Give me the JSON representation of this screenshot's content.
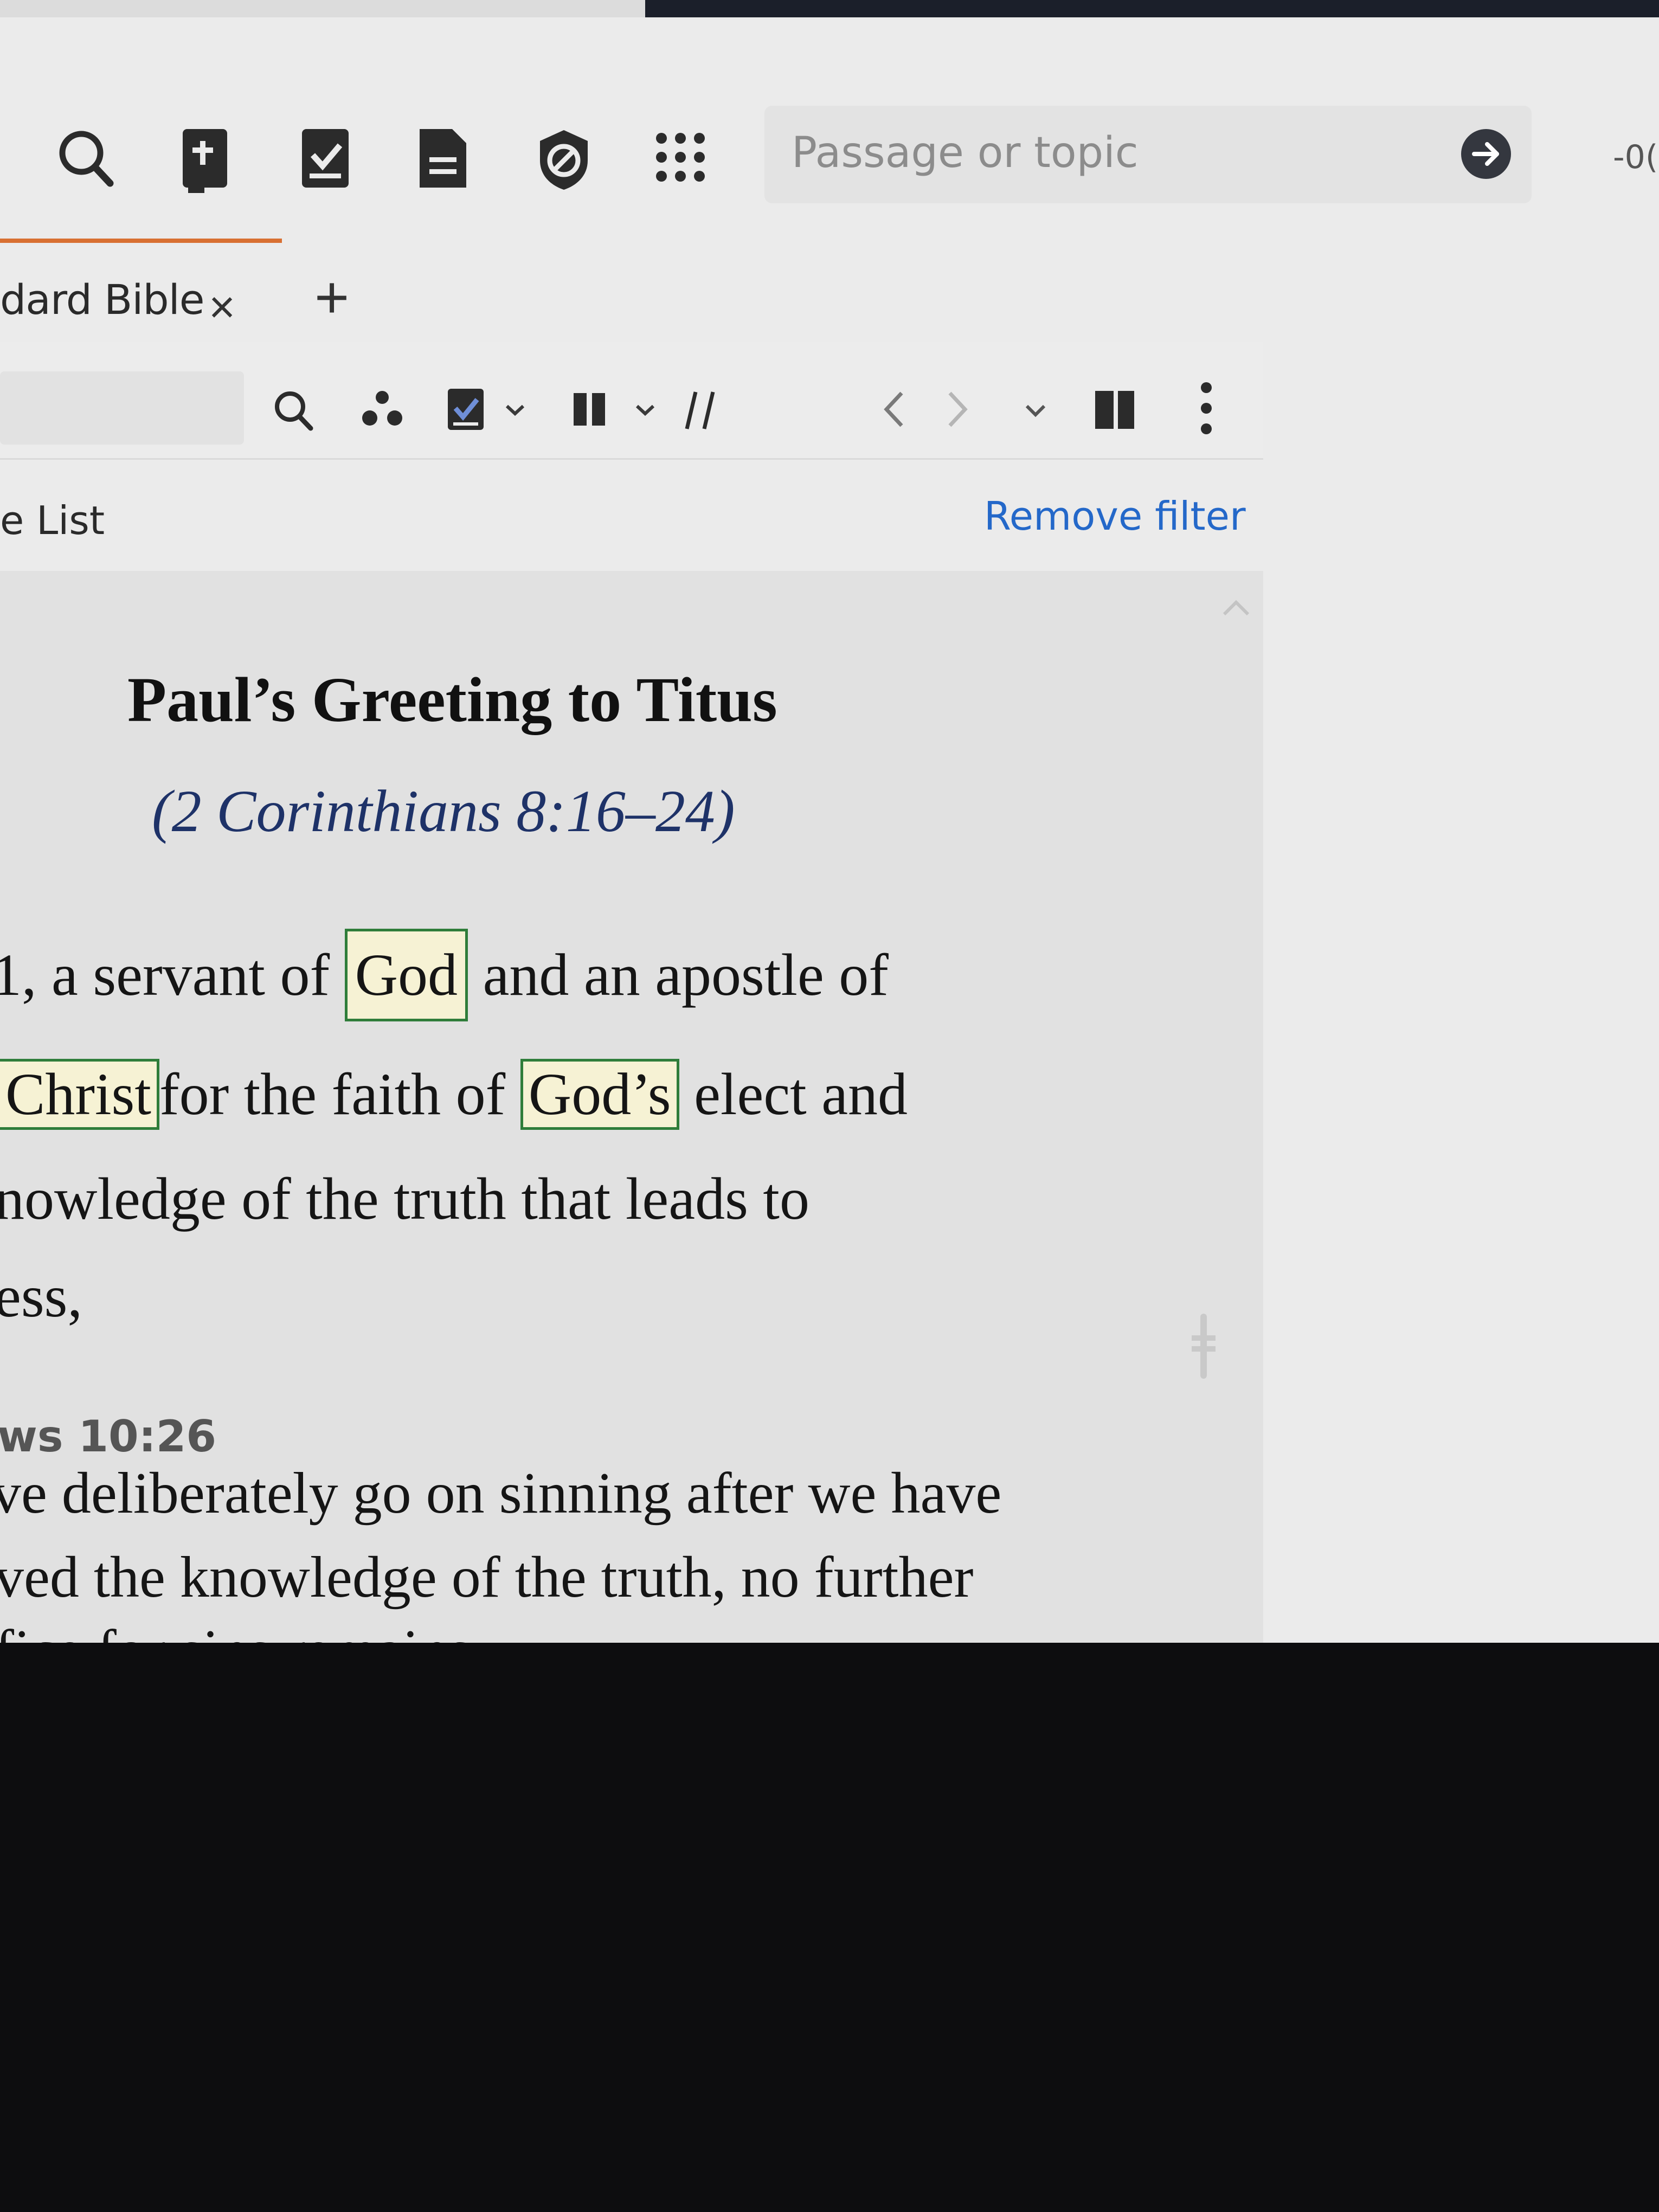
{
  "toolbar": {
    "icons": [
      "search-icon",
      "bible-icon",
      "checklist-icon",
      "document-icon",
      "shield-icon",
      "apps-grid-icon"
    ],
    "search_placeholder": "Passage or topic",
    "edge_text": "-0("
  },
  "tabs": [
    {
      "label": "dard Bible",
      "close_label": "×"
    }
  ],
  "add_tab_label": "+",
  "panel_toolbar": {
    "icons": [
      "search-icon",
      "visual-filter-icon",
      "highlight-check-icon",
      "chevron-down-icon",
      "parallel-columns-icon",
      "chevron-down-icon",
      "interlinear-icon",
      "previous-icon",
      "next-icon",
      "chevron-down-icon",
      "split-panel-icon",
      "more-options-icon"
    ]
  },
  "filter_bar": {
    "label": "e List",
    "remove_filter": "Remove filter"
  },
  "passage": {
    "heading": "Paul’s Greeting to Titus",
    "cross_reference": "(2 Corinthians 8:16–24)",
    "line1_prefix": "1, a servant of ",
    "line1_highlight": "God",
    "line1_suffix": " and an apostle of",
    "line2_highlight1": "Christ",
    "line2_middle": "for the faith of ",
    "line2_highlight2": "God’s",
    "line2_suffix": " elect and",
    "line3": "nowledge of the truth that leads to",
    "line4": "ess,"
  },
  "cross_ref_panel": {
    "heading": "ws 10:26",
    "line1": "ve deliberately go on sinning after we have",
    "line2": "ved the knowledge of the truth, no further",
    "line3": "fice for sins remains"
  },
  "colors": {
    "accent": "#d87032",
    "link": "#2468c9",
    "highlight_border": "#2f7d3a",
    "cross_ref_text": "#1e3268"
  }
}
